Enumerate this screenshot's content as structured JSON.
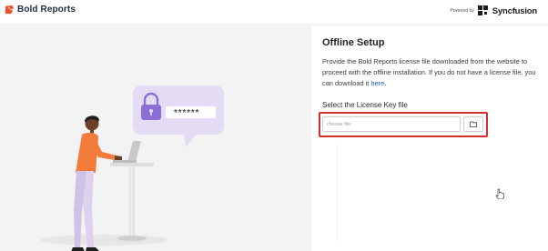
{
  "header": {
    "app_name": "Bold Reports",
    "powered_by": "Powered by",
    "vendor": "Syncfusion"
  },
  "illustration": {
    "password_mask": "******"
  },
  "panel": {
    "title": "Offline Setup",
    "description_prefix": "Provide the Bold Reports license file downloaded from the website to proceed with the offline installation. If you do not have a license file, you can download it",
    "description_link": "here",
    "description_suffix": ".",
    "label": "Select the License Key file",
    "file_input_placeholder": "choose file"
  },
  "colors": {
    "brand": "#e8552b",
    "accent_purple": "#8b6fd6",
    "highlight_red": "#d32f2f",
    "link_blue": "#1565c0"
  }
}
